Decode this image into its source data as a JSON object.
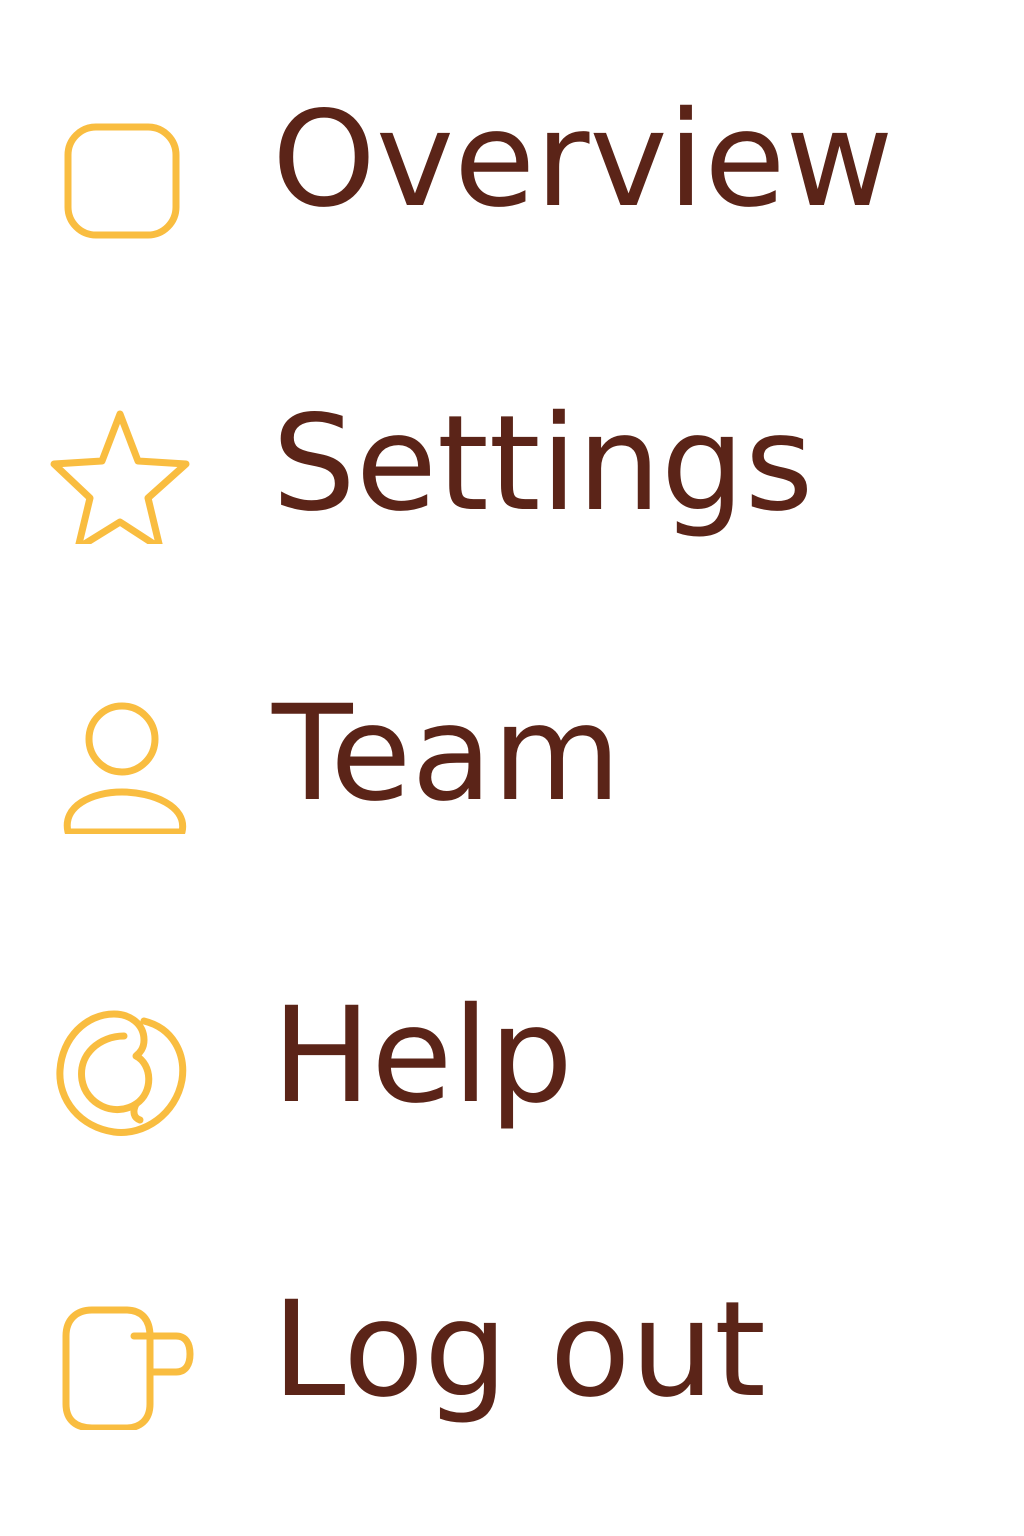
{
  "theme": {
    "icon_color": "#f9bd40",
    "text_color": "#5b2418",
    "background": "#ffffff"
  },
  "menu": {
    "items": [
      {
        "label": "Overview",
        "icon": "rounded-square-icon"
      },
      {
        "label": "Settings",
        "icon": "star-icon"
      },
      {
        "label": "Team",
        "icon": "user-icon"
      },
      {
        "label": "Help",
        "icon": "help-swirl-icon"
      },
      {
        "label": "Log out",
        "icon": "mug-icon"
      }
    ]
  }
}
